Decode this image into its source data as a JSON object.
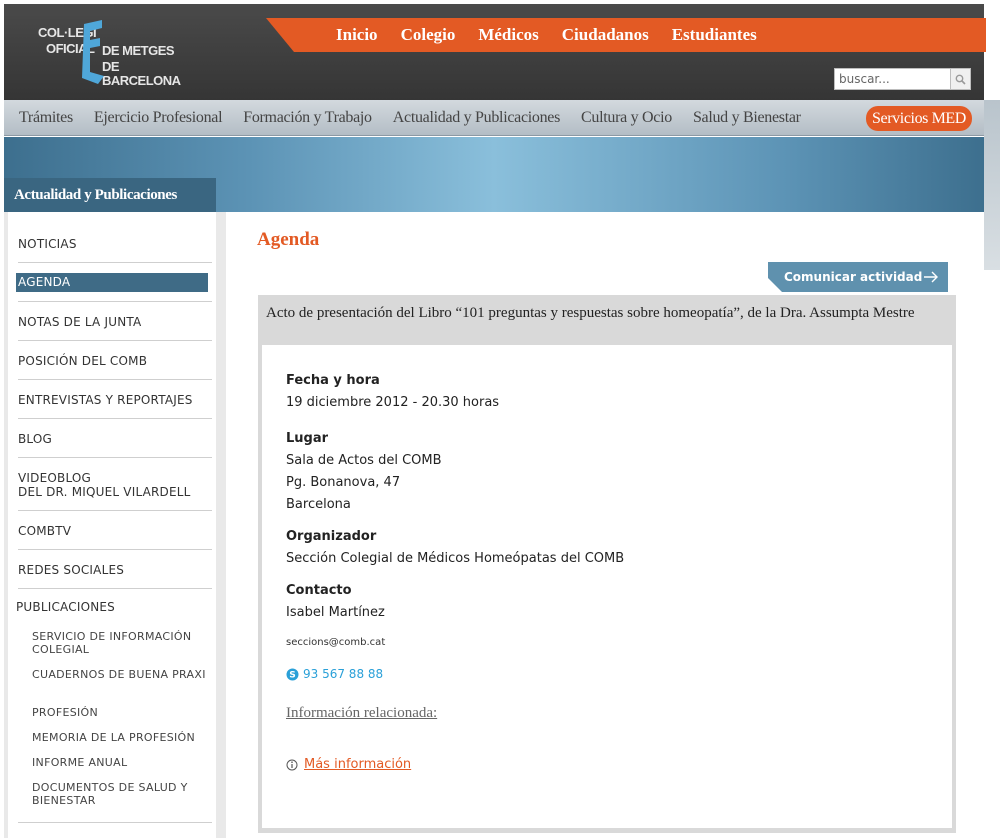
{
  "logo": {
    "line1": "COL·LEGI",
    "line2": "OFICIAL",
    "line3": "DE METGES",
    "line4": "DE BARCELONA"
  },
  "top_nav": [
    "Inicio",
    "Colegio",
    "Médicos",
    "Ciudadanos",
    "Estudiantes"
  ],
  "search": {
    "placeholder": "buscar..."
  },
  "sub_nav": [
    "Trámites",
    "Ejercicio Profesional",
    "Formación y Trabajo",
    "Actualidad y Publicaciones",
    "Cultura y Ocio",
    "Salud y Bienestar"
  ],
  "sub_nav_highlight": "Servicios MED",
  "sidebar": {
    "title": "Actualidad y Publicaciones",
    "items": [
      "NOTICIAS",
      "AGENDA",
      "NOTAS DE LA JUNTA",
      "POSICIÓN DEL COMB",
      "ENTREVISTAS Y REPORTAJES",
      "BLOG",
      "VIDEOBLOG",
      "DEL DR. MIQUEL VILARDELL",
      "COMBTV",
      "REDES SOCIALES",
      "PUBLICACIONES"
    ],
    "active": "AGENDA",
    "sub_items": [
      "SERVICIO DE INFORMACIÓN COLEGIAL",
      "CUADERNOS DE BUENA PRAXI",
      "PROFESIÓN",
      "MEMORIA DE LA PROFESIÓN",
      "INFORME ANUAL",
      "DOCUMENTOS DE SALUD Y BIENESTAR"
    ]
  },
  "main": {
    "title": "Agenda",
    "communicate_button": "Comunicar actividad",
    "event_title": "Acto de presentación del Libro “101 preguntas y respuestas sobre homeopatía”, de la Dra. Assumpta Mestre",
    "date_label": "Fecha y hora",
    "date_value": "19 diciembre 2012 - 20.30 horas",
    "place_label": "Lugar",
    "place_lines": [
      "Sala de Actos del COMB",
      "Pg. Bonanova, 47",
      "Barcelona"
    ],
    "organizer_label": "Organizador",
    "organizer_value": "Sección Colegial de Médicos Homeópatas del COMB",
    "contact_label": "Contacto",
    "contact_name": "Isabel Martínez",
    "contact_email": "seccions@comb.cat",
    "contact_phone": "93 567 88 88",
    "related_label": "Información relacionada:",
    "more_info": "Más información"
  },
  "colors": {
    "accent_orange": "#e35a24",
    "header_dark": "#3f3f3f",
    "active_blue": "#3f6b86",
    "phone_blue": "#2aa0d8"
  },
  "icons": [
    "search-icon",
    "arrow-right-icon",
    "skype-icon",
    "info-icon"
  ]
}
